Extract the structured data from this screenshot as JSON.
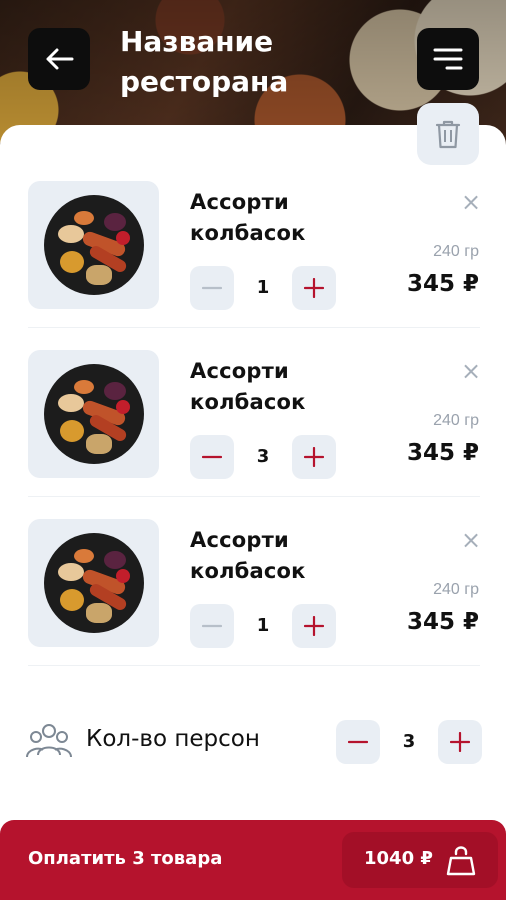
{
  "header": {
    "title_line1": "Название",
    "title_line2": "ресторана",
    "back_icon": "arrow-left-icon",
    "menu_icon": "menu-icon",
    "trash_icon": "trash-icon"
  },
  "cart": {
    "items": [
      {
        "name_line1": "Ассорти",
        "name_line2": "колбасок",
        "weight": "240 гр",
        "price": "345 ₽",
        "quantity": "1",
        "minus_active": false
      },
      {
        "name_line1": "Ассорти",
        "name_line2": "колбасок",
        "weight": "240 гр",
        "price": "345 ₽",
        "quantity": "3",
        "minus_active": true
      },
      {
        "name_line1": "Ассорти",
        "name_line2": "колбасок",
        "weight": "240 гр",
        "price": "345 ₽",
        "quantity": "1",
        "minus_active": false
      }
    ],
    "remove_symbol": "×"
  },
  "persons": {
    "label": "Кол-во персон",
    "value": "3",
    "icon": "people-icon"
  },
  "checkout": {
    "label": "Оплатить 3 товара",
    "total": "1040 ₽",
    "icon": "shopping-bag-icon"
  },
  "colors": {
    "accent": "#b5132d",
    "button_bg": "#e9eef4",
    "muted": "#a6afba"
  }
}
